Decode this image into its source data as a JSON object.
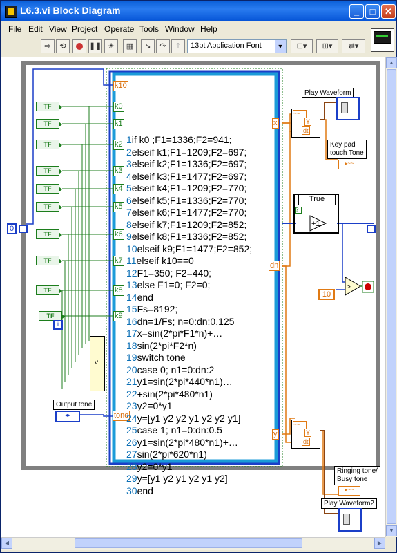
{
  "window": {
    "title": "L6.3.vi Block Diagram"
  },
  "menu": [
    "File",
    "Edit",
    "View",
    "Project",
    "Operate",
    "Tools",
    "Window",
    "Help"
  ],
  "toolbar": {
    "font": "13pt Application Font"
  },
  "diagram": {
    "left_const": "0",
    "case_selector": "True",
    "const_10": "10",
    "controls": [
      "TF",
      "TF",
      "TF",
      "TF",
      "TF",
      "TF",
      "TF",
      "TF",
      "TF",
      "TF"
    ],
    "iter_label": "i",
    "input_terms": [
      "k10",
      "k0",
      "k1",
      "k2",
      "k3",
      "k4",
      "k5",
      "k6",
      "k7",
      "k8",
      "k9",
      "tone"
    ],
    "output_terms": [
      "x",
      "dn",
      "y"
    ],
    "build_label": "Y",
    "dt_label": "dt",
    "play_waveform": "Play Waveform",
    "play_waveform2": "Play Waveform2",
    "keypad_tone": "Key pad\ntouch Tone",
    "ringing_tone": "Ringing tone/\nBusy tone",
    "output_tone": "Output tone",
    "question": "?"
  },
  "script_lines": [
    {
      "n": "1",
      "t": "if  k0 ;F1=1336;F2=941;"
    },
    {
      "n": "2",
      "t": "elseif k1;F1=1209;F2=697;"
    },
    {
      "n": "3",
      "t": "elseif k2;F1=1336;F2=697;"
    },
    {
      "n": "4",
      "t": "elseif k3;F1=1477;F2=697;"
    },
    {
      "n": "5",
      "t": "elseif k4;F1=1209;F2=770;"
    },
    {
      "n": "6",
      "t": "elseif k5;F1=1336;F2=770;"
    },
    {
      "n": "7",
      "t": "elseif k6;F1=1477;F2=770;"
    },
    {
      "n": "8",
      "t": "elseif k7;F1=1209;F2=852;"
    },
    {
      "n": "9",
      "t": "elseif k8;F1=1336;F2=852;"
    },
    {
      "n": "10",
      "t": "elseif k9;F1=1477;F2=852;"
    },
    {
      "n": "11",
      "t": "elseif k10==0"
    },
    {
      "n": "12",
      "t": "F1=350; F2=440;"
    },
    {
      "n": "13",
      "t": "else F1=0; F2=0;"
    },
    {
      "n": "14",
      "t": "end"
    },
    {
      "n": "15",
      "t": "Fs=8192;"
    },
    {
      "n": "16",
      "t": "dn=1/Fs; n=0:dn:0.125"
    },
    {
      "n": "17",
      "t": "x=sin(2*pi*F1*n)+…"
    },
    {
      "n": "18",
      "t": "sin(2*pi*F2*n)"
    },
    {
      "n": "19",
      "t": "switch tone"
    },
    {
      "n": "20",
      "t": "case 0; n1=0:dn:2"
    },
    {
      "n": "21",
      "t": "y1=sin(2*pi*440*n1)…"
    },
    {
      "n": "22",
      "t": "+sin(2*pi*480*n1)"
    },
    {
      "n": "23",
      "t": "y2=0*y1"
    },
    {
      "n": "24",
      "t": "y=[y1 y2 y2 y1 y2 y2 y1]"
    },
    {
      "n": "25",
      "t": "case 1; n1=0:dn:0.5"
    },
    {
      "n": "26",
      "t": "y1=sin(2*pi*480*n1)+…"
    },
    {
      "n": "27",
      "t": "sin(2*pi*620*n1)"
    },
    {
      "n": "28",
      "t": "y2=0*y1"
    },
    {
      "n": "29",
      "t": "y=[y1 y2 y1 y2 y1 y2]"
    },
    {
      "n": "30",
      "t": "end"
    }
  ],
  "colors": {
    "titlebar": "#0a5fd8",
    "wire_blue": "#1b3fc8",
    "wire_orange": "#e07a14",
    "wire_green": "#1c7d1c",
    "loop_gray": "#808080"
  }
}
